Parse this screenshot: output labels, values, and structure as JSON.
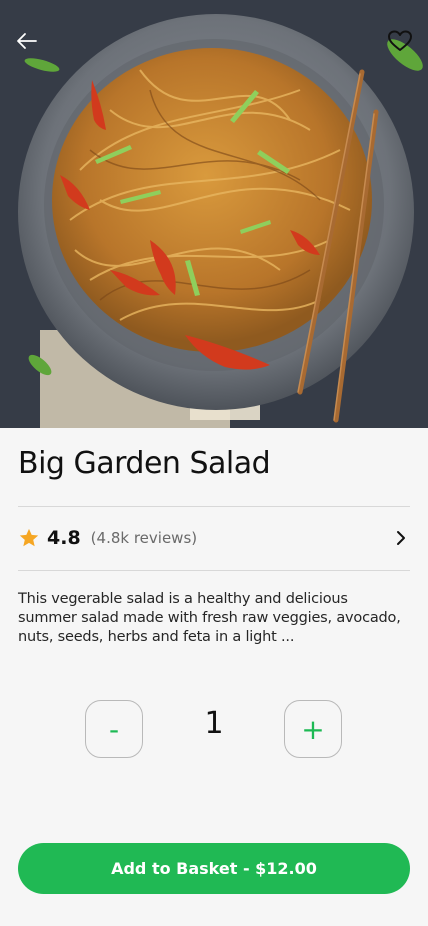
{
  "product": {
    "title": "Big Garden Salad",
    "rating": "4.8",
    "reviews": "(4.8k reviews)",
    "description": "This vegerable salad is a healthy and delicious summer salad made with fresh raw veggies, avocado, nuts, seeds, herbs and feta in a light ...",
    "image_alt": "Noodles with vegetables in a grey bowl with chopsticks"
  },
  "quantity": {
    "minus_label": "-",
    "plus_label": "+",
    "value": "1"
  },
  "cta": {
    "label": "Add to Basket - $12.00"
  },
  "icons": {
    "back": "arrow-left-icon",
    "favorite": "heart-icon",
    "rating": "star-icon",
    "chevron": "chevron-right-icon"
  },
  "colors": {
    "accent": "#20b954",
    "star": "#f5a623",
    "background": "#f6f6f6"
  }
}
